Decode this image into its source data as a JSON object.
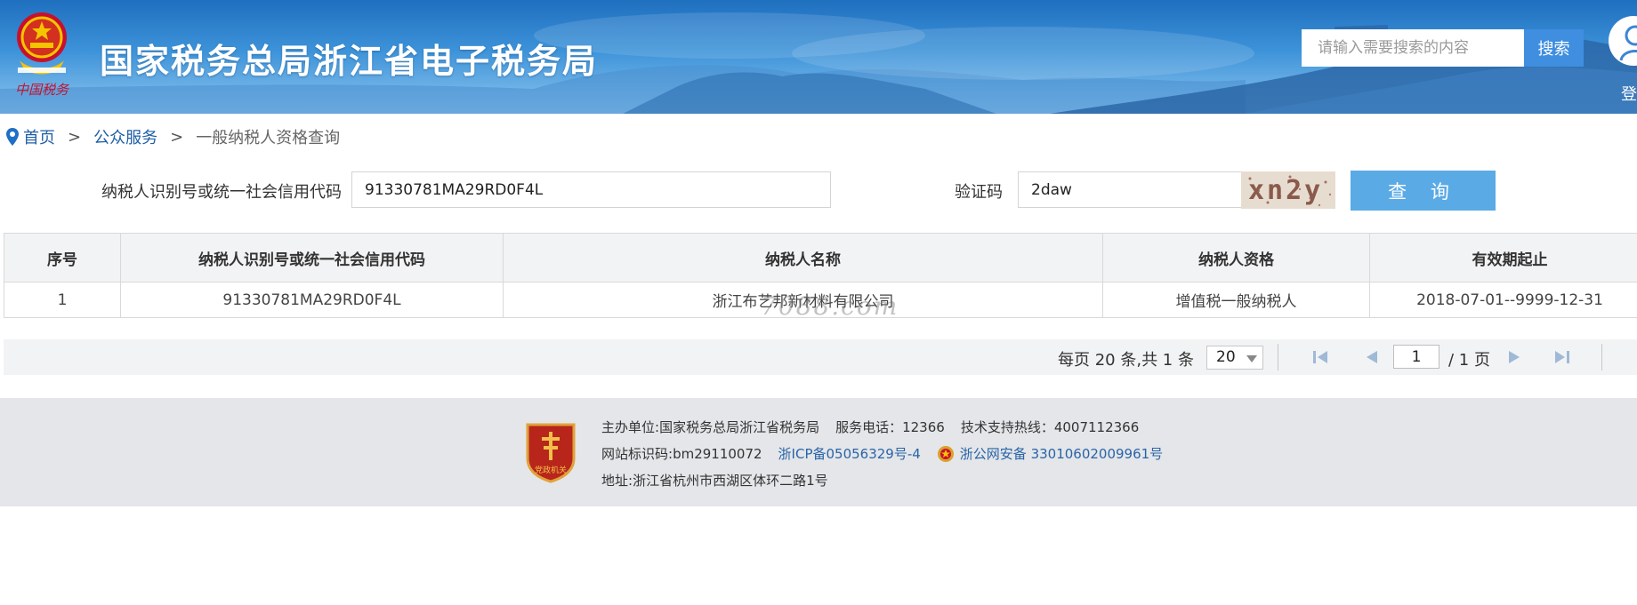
{
  "header": {
    "site_title": "国家税务总局浙江省电子税务局",
    "emblem_caption": "中国税务",
    "search_placeholder": "请输入需要搜索的内容",
    "search_button": "搜索",
    "login_label": "登"
  },
  "breadcrumb": {
    "home": "首页",
    "sep1": ">",
    "public_services": "公众服务",
    "sep2": ">",
    "current": "一般纳税人资格查询"
  },
  "query_form": {
    "taxpayer_code_label": "纳税人识别号或统一社会信用代码",
    "taxpayer_code_value": "91330781MA29RD0F4L",
    "captcha_label": "验证码",
    "captcha_value": "2daw",
    "captcha_image_text": "xn2y",
    "query_button": "查 询"
  },
  "table": {
    "columns": [
      "序号",
      "纳税人识别号或统一社会信用代码",
      "纳税人名称",
      "纳税人资格",
      "有效期起止"
    ],
    "rows": [
      [
        "1",
        "91330781MA29RD0F4L",
        "浙江布艺邦新材料有限公司",
        "增值税一般纳税人",
        "2018-07-01--9999-12-31"
      ]
    ]
  },
  "watermark": "7088.com",
  "pager": {
    "summary": "每页 20 条,共 1 条",
    "page_size": "20",
    "current_page": "1",
    "total_pages": "/ 1 页"
  },
  "footer": {
    "logo_caption": "党政机关",
    "host_label": "主办单位:",
    "host_value": "国家税务总局浙江省税务局",
    "phone_label": "服务电话：",
    "phone_value": "12366",
    "support_label": "技术支持热线：",
    "support_value": "4007112366",
    "site_id_label": "网站标识码:",
    "site_id_value": "bm29110072",
    "icp": "浙ICP备05056329号-4",
    "police_record": "浙公网安备 33010602009961号",
    "address_label": "地址:",
    "address_value": "浙江省杭州市西湖区体环二路1号"
  },
  "colors": {
    "header_blue": "#2a7cc7",
    "link_blue": "#1f5fa6",
    "query_button": "#5aaae6",
    "search_button": "#3f8ee0",
    "footer_bg": "#e4e6e9"
  }
}
